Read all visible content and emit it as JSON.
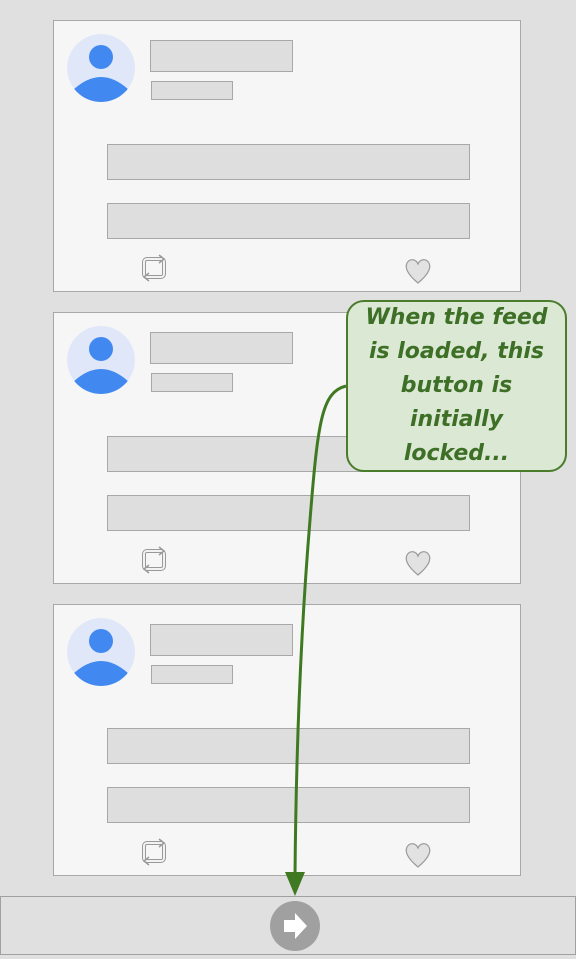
{
  "feed": {
    "posts": [
      {
        "avatar_icon": "user-avatar-icon",
        "repost_icon": "repost-icon",
        "like_icon": "heart-icon"
      },
      {
        "avatar_icon": "user-avatar-icon",
        "repost_icon": "repost-icon",
        "like_icon": "heart-icon"
      },
      {
        "avatar_icon": "user-avatar-icon",
        "repost_icon": "repost-icon",
        "like_icon": "heart-icon"
      }
    ]
  },
  "toolbar": {
    "next_button_icon": "arrow-right-icon",
    "next_button_state": "locked"
  },
  "annotation": {
    "text": "When the feed is loaded, this button is initially locked..."
  },
  "colors": {
    "background": "#e0e0e0",
    "card": "#f6f6f6",
    "placeholder": "#dedede",
    "avatar_bg": "#dfe7f9",
    "avatar_fg": "#4189f0",
    "callout_bg": "#dbe8d4",
    "callout_accent": "#3d7026",
    "locked_button": "#a0a0a0"
  }
}
